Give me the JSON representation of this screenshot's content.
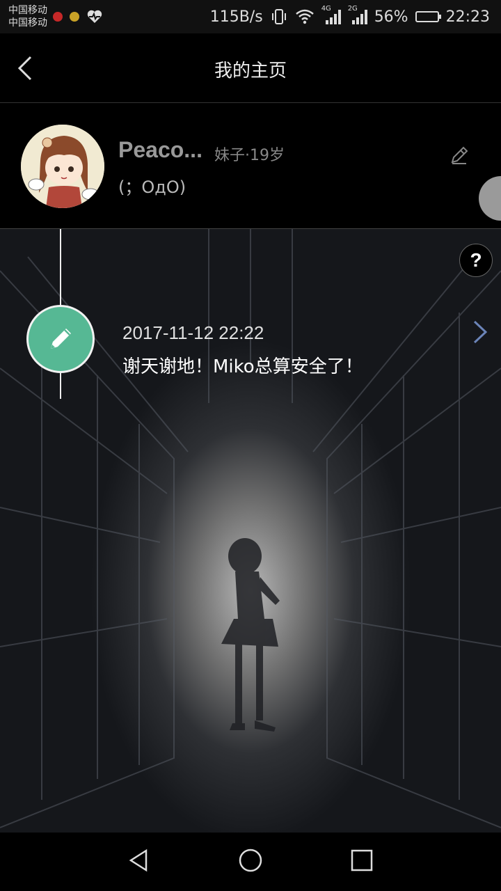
{
  "status_bar": {
    "carrier_1": "中国移动",
    "carrier_2": "中国移动",
    "net_speed": "115B/s",
    "network_1": "4G",
    "network_2": "2G",
    "battery_percent_text": "56%",
    "battery_level": 0.56,
    "time": "22:23"
  },
  "header": {
    "title": "我的主页",
    "back_icon": "back-chevron-icon"
  },
  "profile": {
    "username": "Peaco...",
    "gender_age": "妹子·19岁",
    "signature": "(；ОдО)",
    "edit_icon": "pencil-icon"
  },
  "timeline": {
    "entries": [
      {
        "date": "2017-11-12 22:22",
        "text": "谢天谢地！Miko总算安全了！",
        "icon": "pencil-icon"
      }
    ],
    "help_label": "?"
  },
  "colors": {
    "accent_green": "#56b894",
    "background": "#000000"
  },
  "system_nav": {
    "back": "triangle-back-icon",
    "home": "circle-home-icon",
    "recent": "square-recent-icon"
  }
}
